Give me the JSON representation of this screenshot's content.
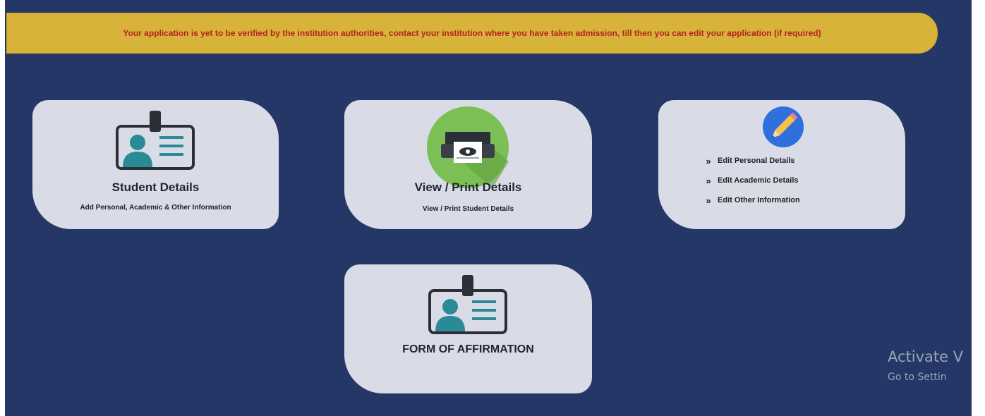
{
  "notice": {
    "text": "Your application is yet to be verified by the institution authorities, contact your institution where you have taken admission, till then you can edit your application (if required)"
  },
  "cards": {
    "student": {
      "title": "Student Details",
      "subtitle": "Add Personal, Academic & Other Information",
      "icon": "id-card-icon"
    },
    "print": {
      "title": "View / Print Details",
      "subtitle": "View / Print Student Details",
      "icon": "printer-icon"
    },
    "edit": {
      "icon": "pencil-icon",
      "items": [
        {
          "chevron": "»",
          "label": "Edit Personal Details"
        },
        {
          "chevron": "»",
          "label": "Edit Academic Details"
        },
        {
          "chevron": "»",
          "label": "Edit Other Information"
        }
      ]
    },
    "affirmation": {
      "title": "FORM OF AFFIRMATION",
      "icon": "id-card-icon"
    }
  },
  "watermark": {
    "line1": "Activate V",
    "line2": "Go to Settin"
  },
  "colors": {
    "background": "#243766",
    "card": "#d9dce6",
    "notice_bg": "#d8b33a",
    "notice_text": "#b52222",
    "icon_teal": "#2a8a96",
    "printer_green": "#7cbf54",
    "pencil_blue": "#2f6fde"
  }
}
